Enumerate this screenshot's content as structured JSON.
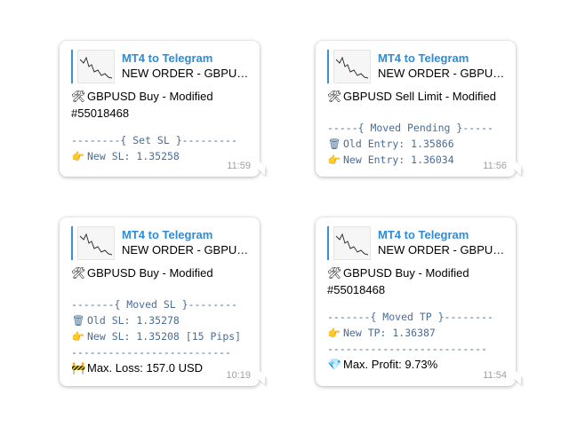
{
  "messages": [
    {
      "reply_title": "MT4 to Telegram",
      "reply_sub": "NEW ORDER - GBPUSD...",
      "line1_icon": "tools-icon",
      "line1": "GBPUSD Buy - Modified",
      "line2": "#55018468",
      "section": "--------{ Set SL }---------",
      "rows": [
        {
          "icon": "pointing-hand-icon",
          "text": "New SL: 1.35258"
        }
      ],
      "time": "11:59"
    },
    {
      "reply_title": "MT4 to Telegram",
      "reply_sub": "NEW ORDER - GBPUSD Sell Li...",
      "line1_icon": "tools-icon",
      "line1": "GBPUSD Sell Limit - Modified",
      "section": "-----{ Moved Pending }-----",
      "rows": [
        {
          "icon": "wastebasket-icon",
          "text": "Old Entry: 1.35866"
        },
        {
          "icon": "pointing-hand-icon",
          "text": "New Entry: 1.36034"
        }
      ],
      "time": "11:56"
    },
    {
      "reply_title": "MT4 to Telegram",
      "reply_sub": "NEW ORDER - GBPUSD...",
      "line1_icon": "tools-icon",
      "line1": "GBPUSD Buy - Modified",
      "section": "-------{ Moved SL }--------",
      "rows": [
        {
          "icon": "wastebasket-icon",
          "text": "Old SL: 1.35278"
        },
        {
          "icon": "pointing-hand-icon",
          "text": "New SL: 1.35208 [15 Pips]"
        }
      ],
      "divider": "--------------------------",
      "footer_icon": "construction-icon",
      "footer": "Max. Loss:  157.0 USD",
      "time": "10:19"
    },
    {
      "reply_title": "MT4 to Telegram",
      "reply_sub": "NEW ORDER - GBPUSD...",
      "line1_icon": "tools-icon",
      "line1": "GBPUSD Buy - Modified",
      "line2": "#55018468",
      "section": "-------{ Moved TP }--------",
      "rows": [
        {
          "icon": "pointing-hand-icon",
          "text": "New TP: 1.36387"
        }
      ],
      "divider": "--------------------------",
      "footer_icon": "gem-icon",
      "footer": "Max. Profit:  9.73%",
      "time": "11:54"
    }
  ]
}
